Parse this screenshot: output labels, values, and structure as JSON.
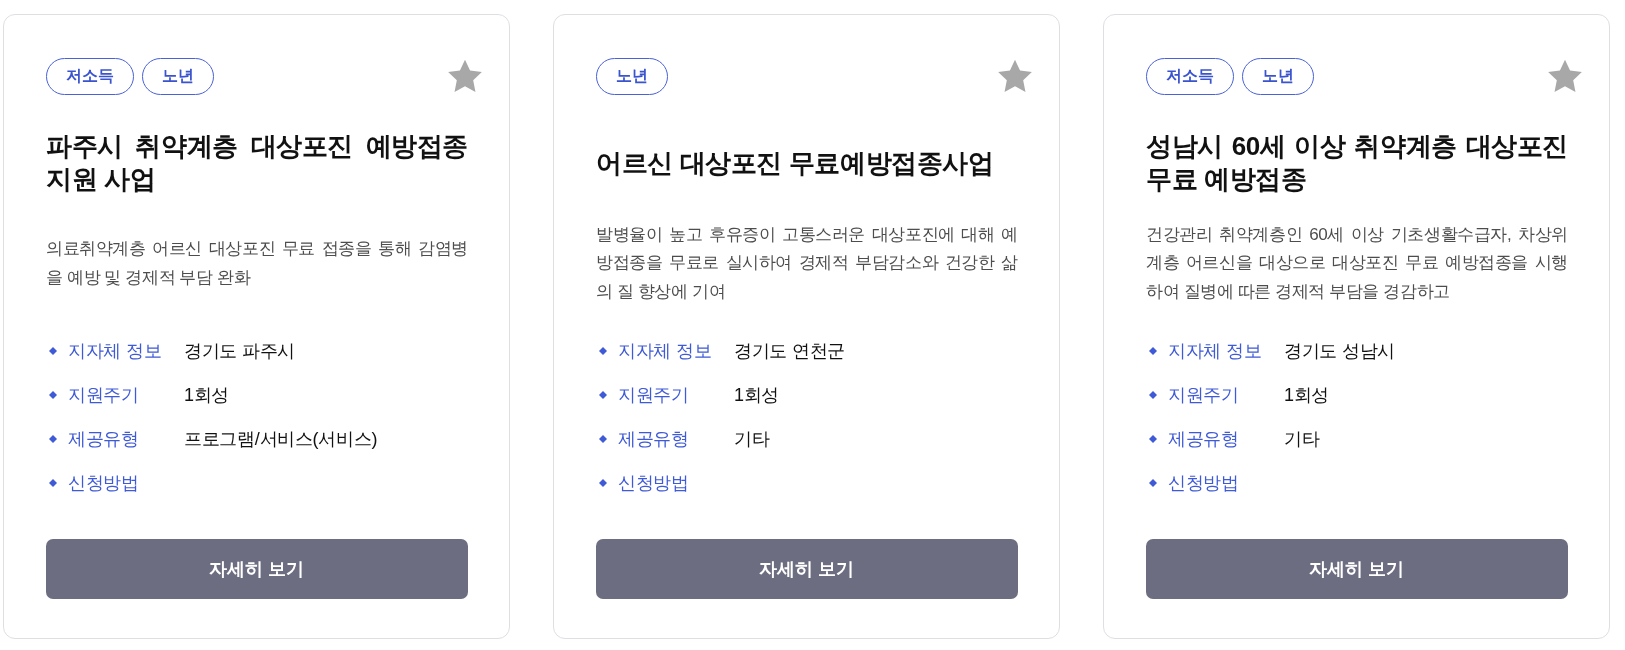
{
  "cards": [
    {
      "tags": [
        "저소득",
        "노년"
      ],
      "bookmarked": false,
      "title": "파주시 취약계층 대상포진 예방접종 지원 사업",
      "description": "의료취약계층 어르신 대상포진 무료 접종을 통해 감염병을 예방 및 경제적 부담 완화",
      "info": [
        {
          "label": "지자체 정보",
          "value": "경기도 파주시"
        },
        {
          "label": "지원주기",
          "value": "1회성"
        },
        {
          "label": "제공유형",
          "value": "프로그램/서비스(서비스)"
        },
        {
          "label": "신청방법"
        }
      ],
      "button": "자세히 보기"
    },
    {
      "tags": [
        "노년"
      ],
      "bookmarked": false,
      "title": "어르신 대상포진 무료예방접종사업",
      "description": "발병율이 높고 후유증이 고통스러운 대상포진에 대해 예방접종을 무료로 실시하여 경제적 부담감소와 건강한 삶의 질 향상에 기여",
      "info": [
        {
          "label": "지자체 정보",
          "value": "경기도 연천군"
        },
        {
          "label": "지원주기",
          "value": "1회성"
        },
        {
          "label": "제공유형",
          "value": "기타"
        },
        {
          "label": "신청방법"
        }
      ],
      "button": "자세히 보기"
    },
    {
      "tags": [
        "저소득",
        "노년"
      ],
      "bookmarked": false,
      "title": "성남시 60세 이상 취약계층 대상포진 무료 예방접종",
      "description": "건강관리 취약계층인 60세 이상 기초생활수급자, 차상위계층 어르신을 대상으로 대상포진 무료 예방접종을 시행하여 질병에 따른 경제적 부담을 경감하고",
      "info": [
        {
          "label": "지자체 정보",
          "value": "경기도 성남시"
        },
        {
          "label": "지원주기",
          "value": "1회성"
        },
        {
          "label": "제공유형",
          "value": "기타"
        },
        {
          "label": "신청방법"
        }
      ],
      "button": "자세히 보기"
    }
  ]
}
